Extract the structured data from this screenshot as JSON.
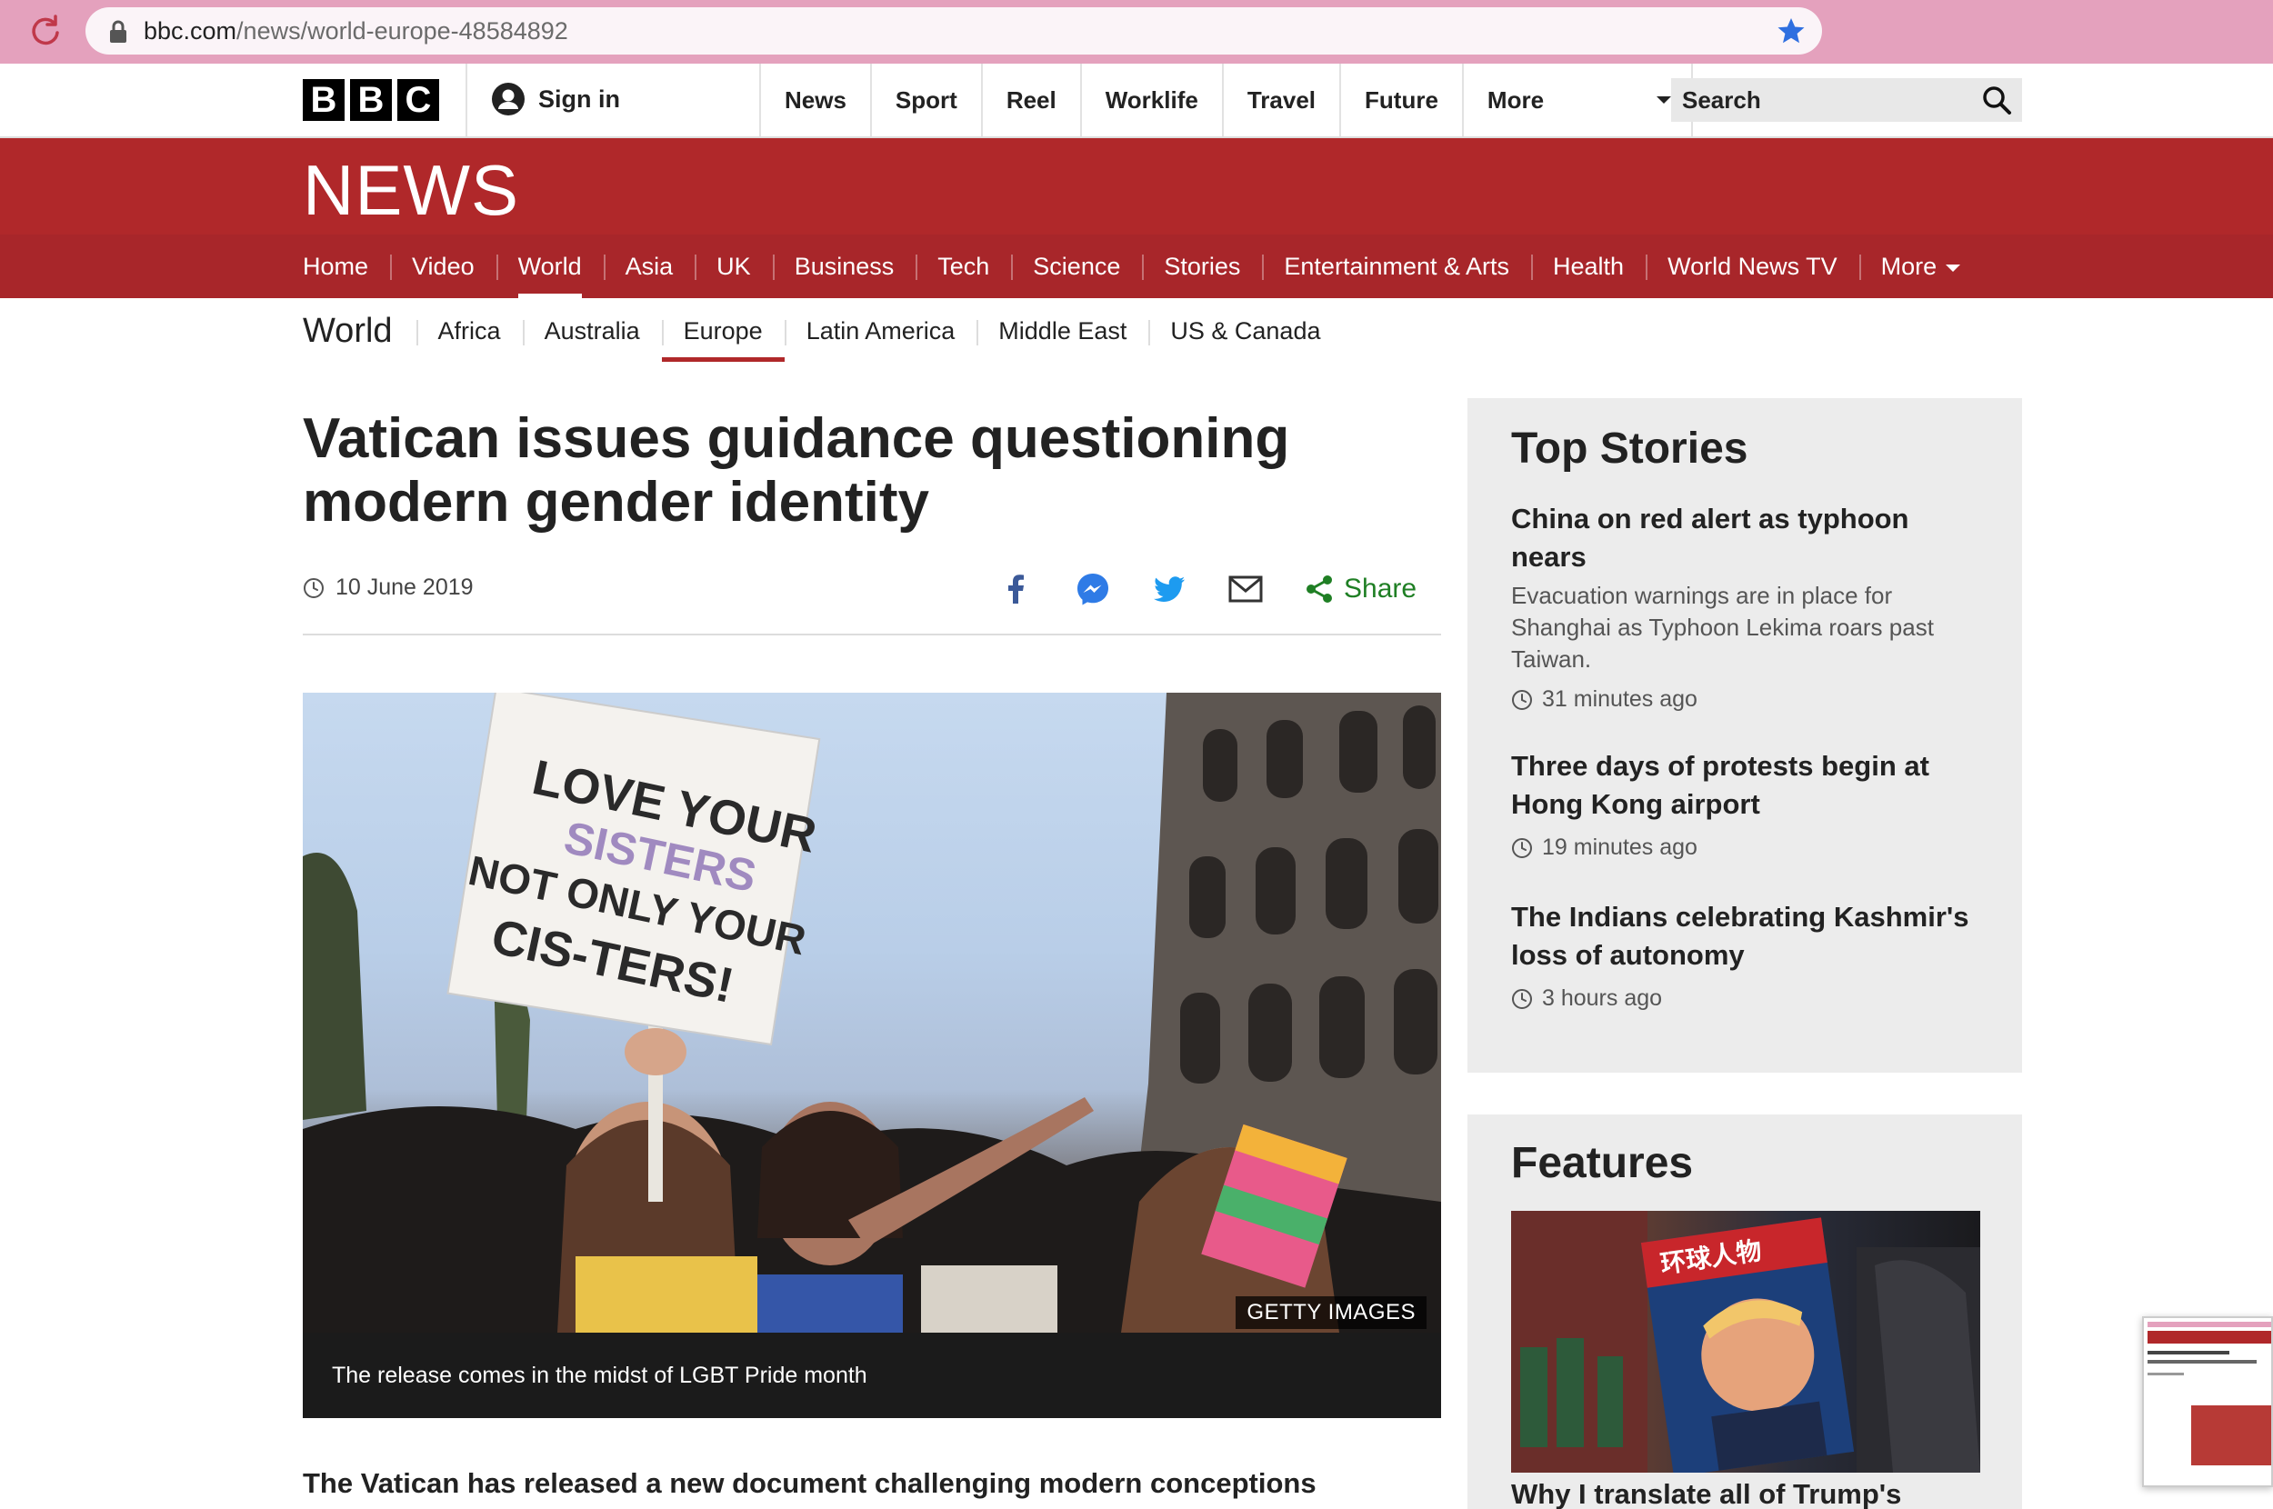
{
  "browser": {
    "url_host": "bbc.com",
    "url_path": "/news/world-europe-48584892"
  },
  "bbc_bar": {
    "logo_letters": [
      "B",
      "B",
      "C"
    ],
    "signin_label": "Sign in",
    "nav": [
      "News",
      "Sport",
      "Reel",
      "Worklife",
      "Travel",
      "Future",
      "More"
    ],
    "search_placeholder": "Search"
  },
  "news": {
    "logo": "NEWS",
    "nav": [
      "Home",
      "Video",
      "World",
      "Asia",
      "UK",
      "Business",
      "Tech",
      "Science",
      "Stories",
      "Entertainment & Arts",
      "Health",
      "World News TV",
      "More"
    ],
    "active": "World"
  },
  "subnav": {
    "section": "World",
    "items": [
      "Africa",
      "Australia",
      "Europe",
      "Latin America",
      "Middle East",
      "US & Canada"
    ],
    "active": "Europe"
  },
  "article": {
    "headline": "Vatican issues guidance questioning modern gender identity",
    "date": "10 June 2019",
    "share_label": "Share",
    "image_credit": "GETTY IMAGES",
    "caption": "The release comes in the midst of LGBT Pride month",
    "lead": "The Vatican has released a new document challenging modern conceptions",
    "sign_lines": [
      "LOVE YOUR",
      "SISTERS",
      "NOT ONLY YOUR",
      "CIS-TERS!"
    ]
  },
  "top_stories": {
    "title": "Top Stories",
    "items": [
      {
        "title": "China on red alert as typhoon nears",
        "summary": "Evacuation warnings are in place for Shanghai as Typhoon Lekima roars past Taiwan.",
        "time": "31 minutes ago"
      },
      {
        "title": "Three days of protests begin at Hong Kong airport",
        "summary": "",
        "time": "19 minutes ago"
      },
      {
        "title": "The Indians celebrating Kashmir's loss of autonomy",
        "summary": "",
        "time": "3 hours ago"
      }
    ]
  },
  "features": {
    "title": "Features",
    "headline": "Why I translate all of Trump's",
    "image_text": "环球人物"
  },
  "colors": {
    "bbc_red": "#b0282a",
    "share_green": "#1f7f24",
    "chrome_pink": "#e4a1bd"
  }
}
